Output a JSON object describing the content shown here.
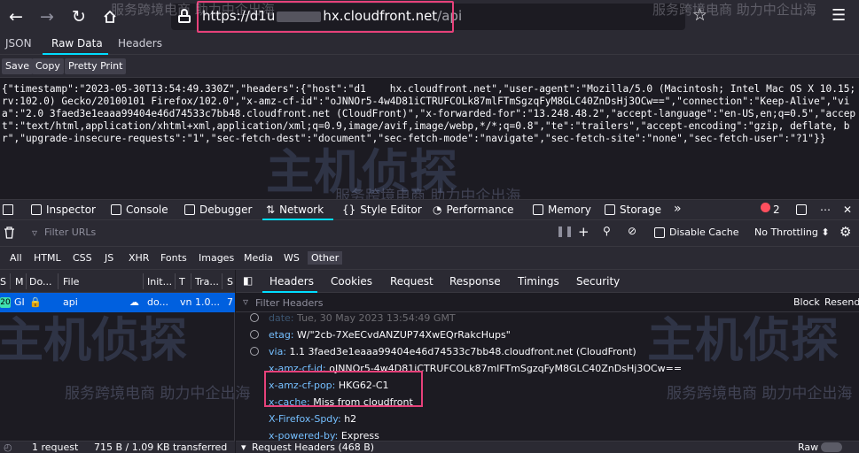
{
  "browser": {
    "url_prefix": "https://d1u",
    "url_host_end": "hx.cloudfront.net",
    "url_path": "/api"
  },
  "watermark": {
    "logo_text": "主机侦探",
    "subtitle": "服务跨境电商 助力中企出海"
  },
  "viewer": {
    "tabs": [
      "JSON",
      "Raw Data",
      "Headers"
    ],
    "active_tab": "Raw Data",
    "buttons": [
      "Save",
      "Copy",
      "Pretty Print"
    ],
    "raw_text": "{\"timestamp\":\"2023-05-30T13:54:49.330Z\",\"headers\":{\"host\":\"d1    hx.cloudfront.net\",\"user-agent\":\"Mozilla/5.0 (Macintosh; Intel Mac OS X 10.15; rv:102.0) Gecko/20100101 Firefox/102.0\",\"x-amz-cf-id\":\"oJNNOr5-4w4D81iCTRUFCOLk87mlFTmSgzqFyM8GLC40ZnDsHj3OCw==\",\"connection\":\"Keep-Alive\",\"via\":\"2.0 3faed3e1eaaa99404e46d74533c7bb48.cloudfront.net (CloudFront)\",\"x-forwarded-for\":\"13.248.48.2\",\"accept-language\":\"en-US,en;q=0.5\",\"accept\":\"text/html,application/xhtml+xml,application/xml;q=0.9,image/avif,image/webp,*/*;q=0.8\",\"te\":\"trailers\",\"accept-encoding\":\"gzip, deflate, br\",\"upgrade-insecure-requests\":\"1\",\"sec-fetch-dest\":\"document\",\"sec-fetch-mode\":\"navigate\",\"sec-fetch-site\":\"none\",\"sec-fetch-user\":\"?1\"}}"
  },
  "devtools": {
    "tools": {
      "inspector": "Inspector",
      "console": "Console",
      "debugger": "Debugger",
      "network": "Network",
      "style_editor": "Style Editor",
      "performance": "Performance",
      "memory": "Memory",
      "storage": "Storage"
    },
    "error_count": "2",
    "filter_placeholder": "Filter URLs",
    "disable_cache": "Disable Cache",
    "throttling": "No Throttling ⬍",
    "types": [
      "All",
      "HTML",
      "CSS",
      "JS",
      "XHR",
      "Fonts",
      "Images",
      "Media",
      "WS",
      "Other"
    ],
    "active_type": "Other",
    "columns": [
      "S",
      "M",
      "Do...",
      "File",
      "Init...",
      "T",
      "Tra...",
      "S"
    ],
    "request": {
      "status": "20",
      "method": "GI",
      "domain": "",
      "file": "api",
      "initiator": "do...",
      "type": "vn",
      "transferred": "1.0...",
      "size": "7"
    },
    "footer": {
      "requests": "1 request",
      "transfer": "715 B / 1.09 KB transferred"
    },
    "detail_tabs": [
      "Headers",
      "Cookies",
      "Request",
      "Response",
      "Timings",
      "Security"
    ],
    "active_detail_tab": "Headers",
    "header_filter_placeholder": "Filter Headers",
    "block": "Block",
    "resend": "Resend",
    "headers": [
      {
        "name": "date:",
        "value": "Tue, 30 May 2023 13:54:49 GMT"
      },
      {
        "name": "etag:",
        "value": "W/\"2cb-7XeECvdANZUP74XwEQrRakcHups\""
      },
      {
        "name": "via:",
        "value": "1.1 3faed3e1eaaa99404e46d74533c7bb48.cloudfront.net (CloudFront)"
      },
      {
        "name": "x-amz-cf-id:",
        "value": "oJNNOr5-4w4D81iCTRUFCOLk87mlFTmSgzqFyM8GLC40ZnDsHj3OCw=="
      },
      {
        "name": "x-amz-cf-pop:",
        "value": "HKG62-C1"
      },
      {
        "name": "x-cache:",
        "value": "Miss from cloudfront"
      },
      {
        "name": "X-Firefox-Spdy:",
        "value": "h2"
      },
      {
        "name": "x-powered-by:",
        "value": "Express"
      }
    ],
    "request_headers": "Request Headers (468 B)",
    "raw_label": "Raw"
  }
}
